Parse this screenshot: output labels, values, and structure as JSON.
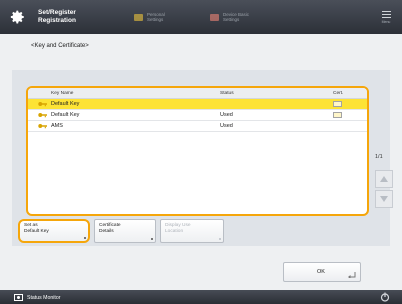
{
  "header": {
    "title_line1": "Set/Register",
    "title_line2": "Registration",
    "personal_settings": {
      "line1": "Personal",
      "line2": "Settings"
    },
    "device_settings": {
      "line1": "Device Basic",
      "line2": "Settings"
    },
    "menu_label": "Menu"
  },
  "breadcrumb": "<Key and Certificate>",
  "table": {
    "columns": [
      "Key Name",
      "Status",
      "Cert."
    ],
    "rows": [
      {
        "name": "Default Key",
        "status": "",
        "cert": true,
        "selected": true
      },
      {
        "name": "Default Key",
        "status": "Used",
        "cert": true,
        "selected": false
      },
      {
        "name": "AMS",
        "status": "Used",
        "cert": false,
        "selected": false
      }
    ]
  },
  "page_indicator": "1/1",
  "buttons": {
    "set_default": {
      "line1": "Set as",
      "line2": "Default Key"
    },
    "cert_details": {
      "line1": "Certificate",
      "line2": "Details"
    },
    "display_use": {
      "line1": "Display Use",
      "line2": "Location"
    },
    "ok": "OK"
  },
  "footer": {
    "status_monitor": "Status Monitor"
  },
  "colors": {
    "accent": "#f5a60b",
    "selection": "#fde335",
    "bar": "#2c3038"
  }
}
